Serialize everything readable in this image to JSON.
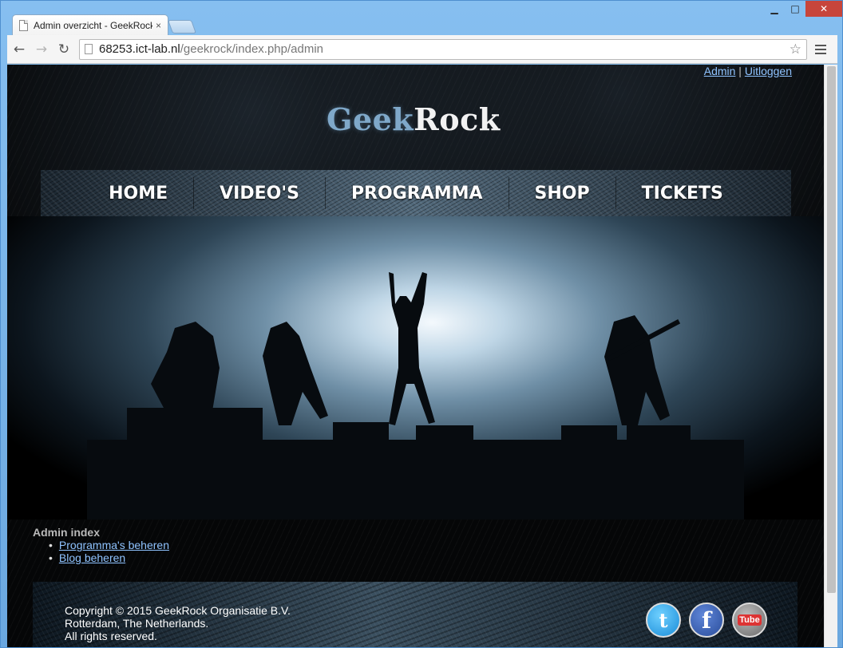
{
  "browser": {
    "tab_title": "Admin overzicht - GeekRock",
    "tab_close": "×",
    "url_host": "68253.ict-lab.nl",
    "url_path": "/geekrock/index.php/admin",
    "back_icon": "←",
    "forward_icon": "→",
    "reload_icon": "↻",
    "star_icon": "☆",
    "minimize_icon": "▁",
    "maximize_icon": "□",
    "close_icon": "✕"
  },
  "topbar": {
    "admin_link": "Admin",
    "separator": " | ",
    "logout_link": "Uitloggen"
  },
  "logo": {
    "part1": "Geek",
    "part2": "Rock"
  },
  "nav": {
    "items": [
      "HOME",
      "VIDEO'S",
      "PROGRAMMA",
      "SHOP",
      "TICKETS"
    ]
  },
  "admin": {
    "title": "Admin index",
    "links": [
      "Programma's beheren",
      "Blog beheren"
    ]
  },
  "footer": {
    "line1": "Copyright © 2015 GeekRock Organisatie B.V.",
    "line2": "Rotterdam, The Netherlands.",
    "line3": "All rights reserved."
  },
  "social": {
    "twitter_glyph": "t",
    "facebook_glyph": "f",
    "youtube_glyph": "Tube"
  },
  "colors": {
    "link": "#8fc3ff",
    "logo_geek": "#7fa8c9",
    "logo_rock": "#f2f2f2",
    "page_bg": "#050607"
  }
}
